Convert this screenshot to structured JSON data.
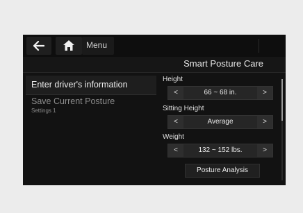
{
  "topbar": {
    "back_icon": "back-arrow-icon",
    "home_icon": "home-icon",
    "menu_label": "Menu"
  },
  "page": {
    "title": "Smart Posture Care"
  },
  "left_panel": {
    "enter_driver_info": "Enter driver's information",
    "save_posture": "Save Current Posture",
    "save_posture_sub": "Settings 1"
  },
  "fields": {
    "height": {
      "label": "Height",
      "value": "66 ~ 68 in."
    },
    "sitting_height": {
      "label": "Sitting Height",
      "value": "Average"
    },
    "weight": {
      "label": "Weight",
      "value": "132 ~ 152 lbs."
    }
  },
  "stepper_glyphs": {
    "decrease": "<",
    "increase": ">"
  },
  "analysis_button": {
    "label": "Posture Analysis"
  }
}
